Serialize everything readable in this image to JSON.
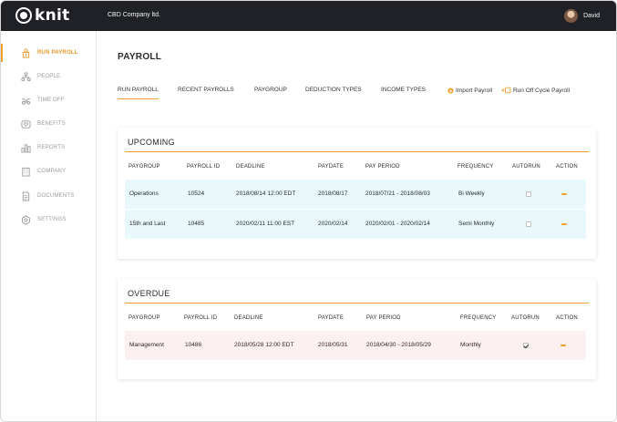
{
  "app": {
    "logo_text": "knit",
    "company": "CBD Company ltd.",
    "user_name": "David"
  },
  "sidebar": {
    "items": [
      {
        "label": "RUN PAYROLL",
        "icon": "run-payroll-icon",
        "active": true
      },
      {
        "label": "PEOPLE",
        "icon": "people-icon",
        "active": false
      },
      {
        "label": "TIME OFF",
        "icon": "time-off-icon",
        "active": false
      },
      {
        "label": "BENEFITS",
        "icon": "benefits-icon",
        "active": false
      },
      {
        "label": "REPORTS",
        "icon": "reports-icon",
        "active": false
      },
      {
        "label": "COMPANY",
        "icon": "company-icon",
        "active": false
      },
      {
        "label": "DOCUMENTS",
        "icon": "documents-icon",
        "active": false
      },
      {
        "label": "SETTINGS",
        "icon": "settings-icon",
        "active": false
      }
    ]
  },
  "main": {
    "title": "PAYROLL",
    "tabs": [
      {
        "label": "RUN PAYROLL",
        "active": true
      },
      {
        "label": "RECENT PAYROLLS",
        "active": false
      },
      {
        "label": "PAYGROUP",
        "active": false
      },
      {
        "label": "DEDUCTION TYPES",
        "active": false
      },
      {
        "label": "INCOME TYPES",
        "active": false
      }
    ],
    "actions": {
      "import_payroll": "Import Payroll",
      "run_off_cycle": "Run Off Cycle Payroll"
    }
  },
  "upcoming": {
    "title": "UPCOMING",
    "headers": [
      "PAYGROUP",
      "PAYROLL ID",
      "DEADLINE",
      "PAYDATE",
      "PAY PERIOD",
      "FREQUENCY",
      "AUTORUN",
      "ACTION"
    ],
    "rows": [
      {
        "paygroup": "Operations",
        "payroll_id": "10524",
        "deadline": "2018/08/14 12:00 EDT",
        "paydate": "2018/08/17",
        "pay_period": "2018/07/21 - 2018/08/03",
        "frequency": "Bi Weekly",
        "autorun": false
      },
      {
        "paygroup": "15th and Last",
        "payroll_id": "10485",
        "deadline": "2020/02/11 11:00 EST",
        "paydate": "2020/02/14",
        "pay_period": "2020/02/01 - 2020/02/14",
        "frequency": "Semi Monthly",
        "autorun": false
      }
    ]
  },
  "overdue": {
    "title": "OVERDUE",
    "headers": [
      "PAYGROUP",
      "PAYROLL ID",
      "DEADLINE",
      "PAYDATE",
      "PAY PERIOD",
      "FREQUENCY",
      "AUTORUN",
      "ACTION"
    ],
    "rows": [
      {
        "paygroup": "Management",
        "payroll_id": "10486",
        "deadline": "2018/05/28 12:00 EDT",
        "paydate": "2018/05/31",
        "pay_period": "2018/04/30 - 2018/05/29",
        "frequency": "Monthly",
        "autorun": true
      }
    ]
  },
  "colors": {
    "accent": "#f0a02c",
    "topbar": "#1f2126",
    "upcoming_row": "#e9f9fb",
    "overdue_row": "#fdf0f0"
  }
}
